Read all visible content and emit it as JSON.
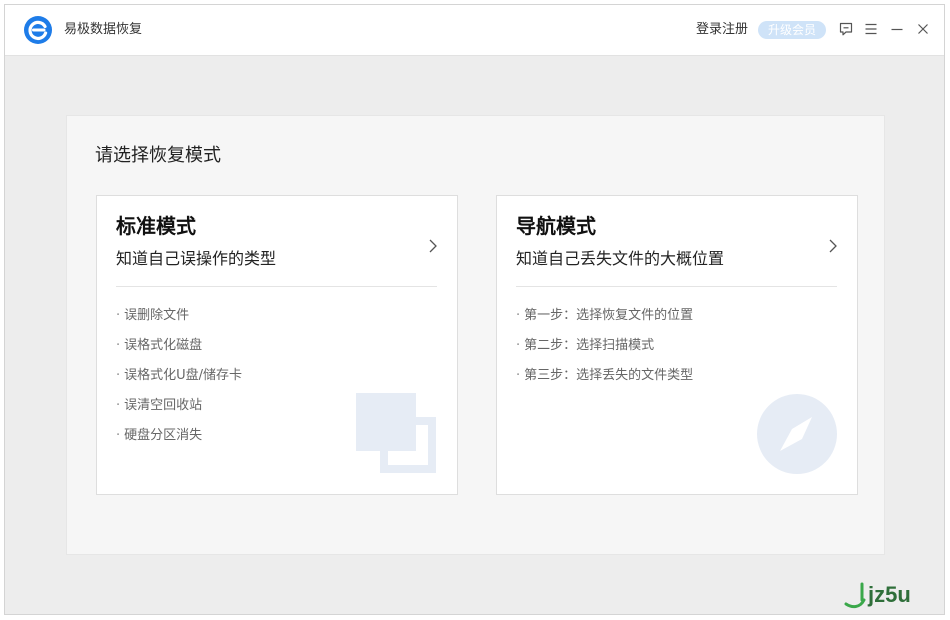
{
  "app": {
    "title": "易极数据恢复",
    "login_label": "登录注册",
    "upgrade_label": "升级会员",
    "accent_color": "#1e7ce8"
  },
  "titlebar_icons": [
    "feedback-icon",
    "menu-icon",
    "minimize-icon",
    "close-icon"
  ],
  "panel": {
    "heading": "请选择恢复模式"
  },
  "cards": [
    {
      "title": "标准模式",
      "subtitle": "知道自己误操作的类型",
      "items": [
        "误删除文件",
        "误格式化磁盘",
        "误格式化U盘/储存卡",
        "误清空回收站",
        "硬盘分区消失"
      ],
      "decor_icon": "copy-squares-icon"
    },
    {
      "title": "导航模式",
      "subtitle": "知道自己丢失文件的大概位置",
      "items": [
        "第一步：选择恢复文件的位置",
        "第二步：选择扫描模式",
        "第三步：选择丢失的文件类型"
      ],
      "decor_icon": "compass-icon"
    }
  ],
  "bullet": "·",
  "watermark": {
    "text": "jz5u"
  }
}
